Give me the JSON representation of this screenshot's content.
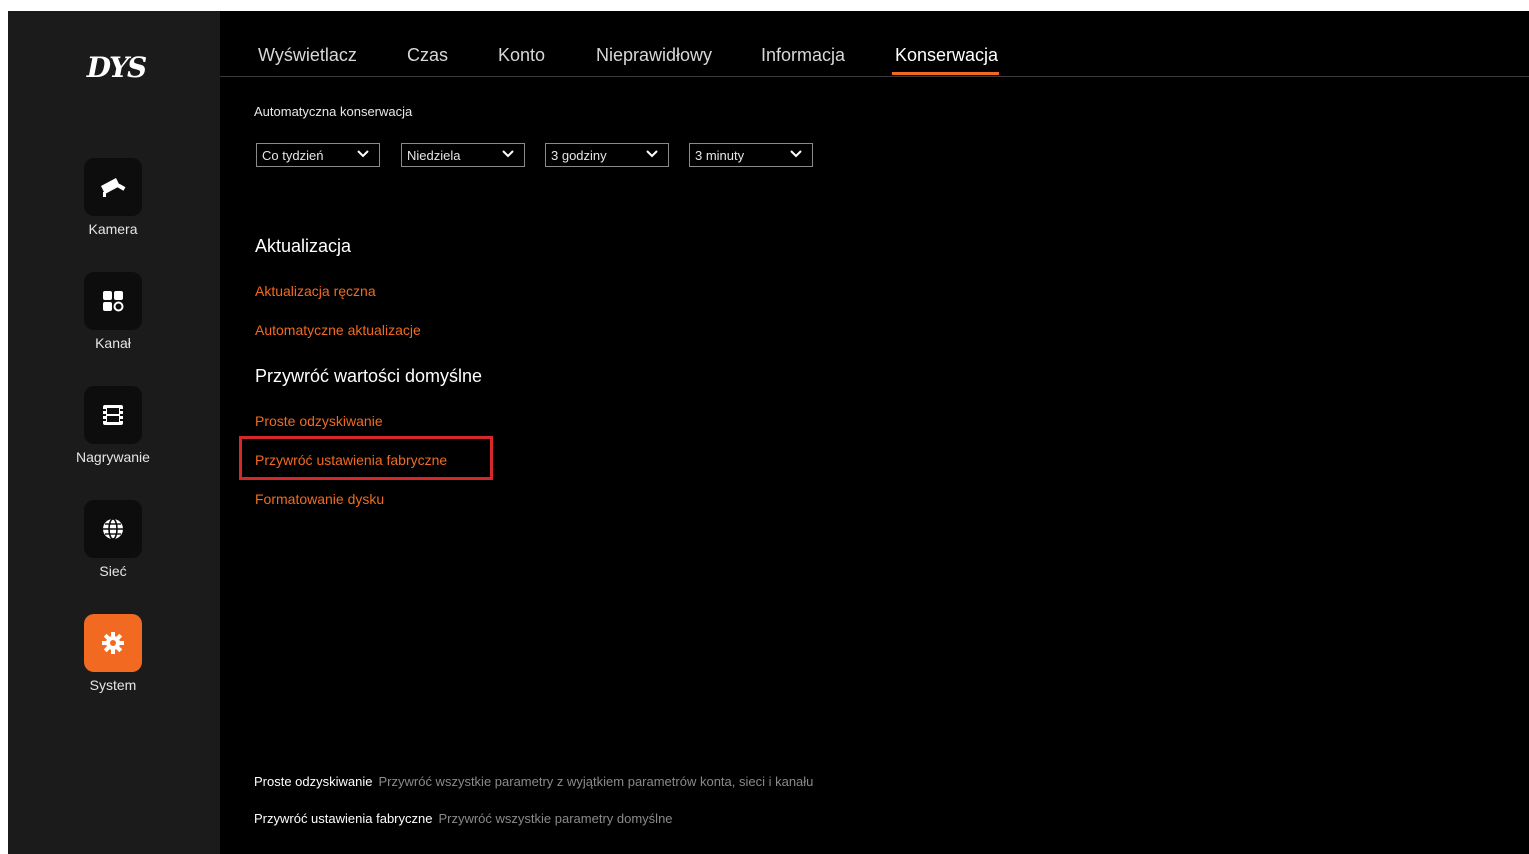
{
  "sidebar": {
    "logo": "DYS",
    "items": [
      {
        "label": "Kamera",
        "icon": "camera-icon",
        "active": false
      },
      {
        "label": "Kanał",
        "icon": "grid-icon",
        "active": false
      },
      {
        "label": "Nagrywanie",
        "icon": "film-icon",
        "active": false
      },
      {
        "label": "Sieć",
        "icon": "globe-icon",
        "active": false
      },
      {
        "label": "System",
        "icon": "gear-icon",
        "active": true
      }
    ]
  },
  "tabs": [
    "Wyświetlacz",
    "Czas",
    "Konto",
    "Nieprawidłowy",
    "Informacja",
    "Konserwacja"
  ],
  "active_tab": "Konserwacja",
  "auto_maintenance": {
    "label": "Automatyczna konserwacja",
    "selects": [
      "Co tydzień",
      "Niedziela",
      "3 godziny",
      "3 minuty"
    ]
  },
  "update": {
    "title": "Aktualizacja",
    "links": [
      "Aktualizacja ręczna",
      "Automatyczne aktualizacje"
    ]
  },
  "restore": {
    "title": "Przywróć wartości domyślne",
    "links": [
      "Proste odzyskiwanie",
      "Przywróć ustawienia fabryczne",
      "Formatowanie dysku"
    ]
  },
  "footnotes": [
    {
      "term": "Proste odzyskiwanie",
      "desc": "Przywróć wszystkie parametry z wyjątkiem parametrów konta, sieci i kanału"
    },
    {
      "term": "Przywróć ustawienia fabryczne",
      "desc": "Przywróć wszystkie parametry domyślne"
    }
  ],
  "colors": {
    "accent": "#f26a21",
    "highlight": "#d6282b",
    "sidebar": "#1b1b1b",
    "background": "#000000"
  }
}
